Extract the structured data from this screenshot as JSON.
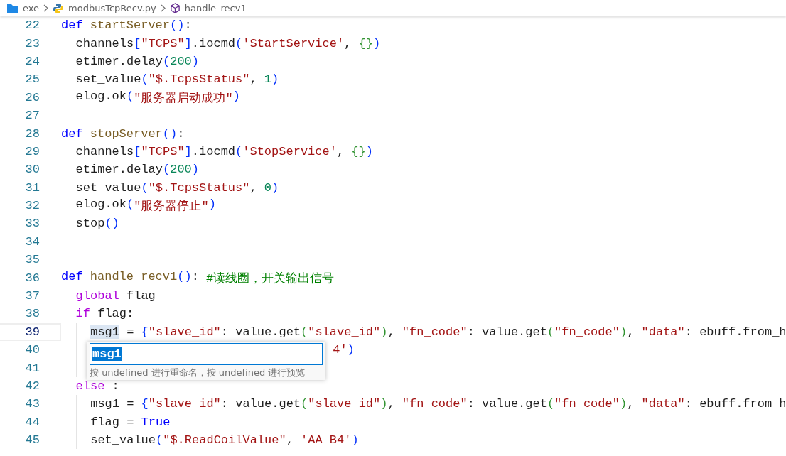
{
  "breadcrumb": [
    {
      "label": "exe",
      "kind": "folder"
    },
    {
      "label": "modbusTcpRecv.py",
      "kind": "python"
    },
    {
      "label": "handle_recv1",
      "kind": "symbol"
    }
  ],
  "lines": [
    {
      "number": "22",
      "current": false,
      "tokens": [
        {
          "text": "def",
          "kind": "kw"
        },
        {
          "text": "startServer",
          "kind": "fn"
        },
        {
          "text": "()",
          "kind": "b1"
        },
        {
          "text": ":",
          "kind": "p"
        }
      ],
      "children": [
        {
          "number": "23",
          "current": false,
          "tokens": [
            {
              "text": "channels",
              "kind": "p"
            },
            {
              "text": "[",
              "kind": "b1"
            },
            {
              "text": "\"TCPS\"",
              "kind": "str"
            },
            {
              "text": "]",
              "kind": "b1"
            },
            {
              "text": ".iocmd",
              "kind": "p"
            },
            {
              "text": "(",
              "kind": "b1"
            },
            {
              "text": "'StartService'",
              "kind": "str"
            },
            {
              "text": ",",
              "kind": "p"
            },
            {
              "text": "{}",
              "kind": "b2"
            },
            {
              "text": ")",
              "kind": "b1"
            }
          ]
        },
        {
          "number": "24",
          "current": false,
          "tokens": [
            {
              "text": "etimer.delay",
              "kind": "p"
            },
            {
              "text": "(",
              "kind": "b1"
            },
            {
              "text": "200",
              "kind": "num"
            },
            {
              "text": ")",
              "kind": "b1"
            }
          ]
        },
        {
          "number": "25",
          "current": false,
          "tokens": [
            {
              "text": "set_value",
              "kind": "p"
            },
            {
              "text": "(",
              "kind": "b1"
            },
            {
              "text": "\"$.TcpsStatus\"",
              "kind": "str"
            },
            {
              "text": ",",
              "kind": "p"
            },
            {
              "text": "1",
              "kind": "num"
            },
            {
              "text": ")",
              "kind": "b1"
            }
          ]
        },
        {
          "number": "26",
          "current": false,
          "tokens": [
            {
              "text": "elog.ok",
              "kind": "p"
            },
            {
              "text": "(",
              "kind": "b1"
            },
            {
              "text": "\"服务器启动成功\"",
              "kind": "str"
            },
            {
              "text": ")",
              "kind": "b1"
            }
          ]
        }
      ]
    },
    {
      "number": "27",
      "current": false
    },
    {
      "number": "28",
      "current": false,
      "tokens": [
        {
          "text": "def",
          "kind": "kw"
        },
        {
          "text": "stopServer",
          "kind": "fn"
        },
        {
          "text": "()",
          "kind": "b1"
        },
        {
          "text": ":",
          "kind": "p"
        }
      ],
      "children": [
        {
          "number": "29",
          "current": false,
          "tokens": [
            {
              "text": "channels",
              "kind": "p"
            },
            {
              "text": "[",
              "kind": "b1"
            },
            {
              "text": "\"TCPS\"",
              "kind": "str"
            },
            {
              "text": "]",
              "kind": "b1"
            },
            {
              "text": ".iocmd",
              "kind": "p"
            },
            {
              "text": "(",
              "kind": "b1"
            },
            {
              "text": "'StopService'",
              "kind": "str"
            },
            {
              "text": ",",
              "kind": "p"
            },
            {
              "text": "{}",
              "kind": "b2"
            },
            {
              "text": ")",
              "kind": "b1"
            }
          ]
        },
        {
          "number": "30",
          "current": false,
          "tokens": [
            {
              "text": "etimer.delay",
              "kind": "p"
            },
            {
              "text": "(",
              "kind": "b1"
            },
            {
              "text": "200",
              "kind": "num"
            },
            {
              "text": ")",
              "kind": "b1"
            }
          ]
        },
        {
          "number": "31",
          "current": false,
          "tokens": [
            {
              "text": "set_value",
              "kind": "p"
            },
            {
              "text": "(",
              "kind": "b1"
            },
            {
              "text": "\"$.TcpsStatus\"",
              "kind": "str"
            },
            {
              "text": ",",
              "kind": "p"
            },
            {
              "text": "0",
              "kind": "num"
            },
            {
              "text": ")",
              "kind": "b1"
            }
          ]
        },
        {
          "number": "32",
          "current": false,
          "tokens": [
            {
              "text": "elog.ok",
              "kind": "p"
            },
            {
              "text": "(",
              "kind": "b1"
            },
            {
              "text": "\"服务器停止\"",
              "kind": "str"
            },
            {
              "text": ")",
              "kind": "b1"
            }
          ]
        },
        {
          "number": "33",
          "current": false,
          "tokens": [
            {
              "text": "stop",
              "kind": "p"
            },
            {
              "text": "()",
              "kind": "b1"
            }
          ]
        }
      ]
    },
    {
      "number": "34",
      "current": false
    },
    {
      "number": "35",
      "current": false
    },
    {
      "number": "36",
      "current": false,
      "tokens": [
        {
          "text": "def",
          "kind": "kw"
        },
        {
          "text": "handle_recv1",
          "kind": "fn"
        },
        {
          "text": "()",
          "kind": "b1"
        },
        {
          "text": ":",
          "kind": "p"
        },
        {
          "text": "#读线圈，开关输出信号",
          "kind": "com"
        }
      ],
      "children": [
        {
          "number": "37",
          "current": false,
          "tokens": [
            {
              "text": "global",
              "kind": "ctrl"
            },
            {
              "text": "flag",
              "kind": "p"
            }
          ]
        },
        {
          "number": "38",
          "current": false,
          "tokens": [
            {
              "text": "if",
              "kind": "ctrl"
            },
            {
              "text": "flag:",
              "kind": "p"
            }
          ],
          "children": [
            {
              "number": "39",
              "current": true,
              "tokens": [
                {
                  "text": "msg1",
                  "kind": "sym"
                },
                {
                  "text": "=",
                  "kind": "p"
                },
                {
                  "text": "{",
                  "kind": "b1"
                },
                {
                  "text": "\"slave_id\"",
                  "kind": "str"
                },
                {
                  "text": ": value.get",
                  "kind": "p"
                },
                {
                  "text": "(",
                  "kind": "b2"
                },
                {
                  "text": "\"slave_id\"",
                  "kind": "str"
                },
                {
                  "text": ")",
                  "kind": "b2"
                },
                {
                  "text": ",",
                  "kind": "p"
                },
                {
                  "text": "\"fn_code\"",
                  "kind": "str"
                },
                {
                  "text": ": value.get",
                  "kind": "p"
                },
                {
                  "text": "(",
                  "kind": "b2"
                },
                {
                  "text": "\"fn_code\"",
                  "kind": "str"
                },
                {
                  "text": ")",
                  "kind": "b2"
                },
                {
                  "text": ",",
                  "kind": "p"
                },
                {
                  "text": "\"data\"",
                  "kind": "str"
                },
                {
                  "text": ": ebuff.from_h",
                  "kind": "p"
                }
              ]
            },
            {
              "number": "40",
              "current": false,
              "kind": "occluded",
              "tokens": [
                {
                  "text": "4'",
                  "kind": "str"
                },
                {
                  "text": ")",
                  "kind": "b1"
                }
              ]
            },
            {
              "number": "41",
              "current": false
            }
          ]
        },
        {
          "number": "42",
          "current": false,
          "tokens": [
            {
              "text": "else",
              "kind": "ctrl"
            },
            {
              "text": ":",
              "kind": "p"
            }
          ],
          "children": [
            {
              "number": "43",
              "current": false,
              "tokens": [
                {
                  "text": "msg1",
                  "kind": "p"
                },
                {
                  "text": "=",
                  "kind": "p"
                },
                {
                  "text": "{",
                  "kind": "b1"
                },
                {
                  "text": "\"slave_id\"",
                  "kind": "str"
                },
                {
                  "text": ": value.get",
                  "kind": "p"
                },
                {
                  "text": "(",
                  "kind": "b2"
                },
                {
                  "text": "\"slave_id\"",
                  "kind": "str"
                },
                {
                  "text": ")",
                  "kind": "b2"
                },
                {
                  "text": ",",
                  "kind": "p"
                },
                {
                  "text": "\"fn_code\"",
                  "kind": "str"
                },
                {
                  "text": ": value.get",
                  "kind": "p"
                },
                {
                  "text": "(",
                  "kind": "b2"
                },
                {
                  "text": "\"fn_code\"",
                  "kind": "str"
                },
                {
                  "text": ")",
                  "kind": "b2"
                },
                {
                  "text": ",",
                  "kind": "p"
                },
                {
                  "text": "\"data\"",
                  "kind": "str"
                },
                {
                  "text": ": ebuff.from_h",
                  "kind": "p"
                }
              ]
            },
            {
              "number": "44",
              "current": false,
              "tokens": [
                {
                  "text": "flag",
                  "kind": "p"
                },
                {
                  "text": "=",
                  "kind": "p"
                },
                {
                  "text": "True",
                  "kind": "kw"
                }
              ]
            },
            {
              "number": "45",
              "current": false,
              "tokens": [
                {
                  "text": "set_value",
                  "kind": "p"
                },
                {
                  "text": "(",
                  "kind": "b1"
                },
                {
                  "text": "\"$.ReadCoilValue\"",
                  "kind": "str"
                },
                {
                  "text": ",",
                  "kind": "p"
                },
                {
                  "text": "'AA B4'",
                  "kind": "str"
                },
                {
                  "text": ")",
                  "kind": "b1"
                }
              ]
            }
          ]
        }
      ]
    }
  ],
  "rename": {
    "value": "msg1",
    "text_selected": true,
    "hint": "按 undefined 进行重命名，按 undefined 进行预览"
  }
}
